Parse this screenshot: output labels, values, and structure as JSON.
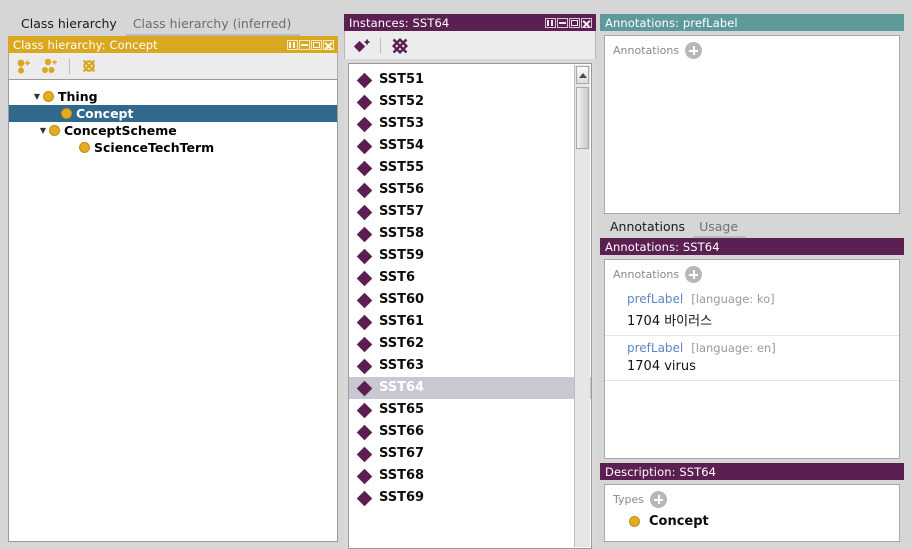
{
  "app": "Protege ontology editor",
  "class_panel": {
    "tabs": [
      {
        "label": "Class hierarchy",
        "active": true
      },
      {
        "label": "Class hierarchy (inferred)",
        "active": false
      }
    ],
    "header_title": "Class hierarchy: Concept",
    "header_color": "#d9a81e",
    "window_controls": [
      "split-icon",
      "minimize-icon",
      "maximize-icon",
      "close-icon"
    ],
    "toolbar": [
      {
        "name": "add-subclass-icon",
        "title": "Add subclass"
      },
      {
        "name": "add-sibling-class-icon",
        "title": "Add sibling class"
      },
      {
        "name": "delete-class-icon",
        "title": "Delete class"
      }
    ],
    "tree": [
      {
        "label": "Thing",
        "depth": 0,
        "twisty": "▼",
        "selected": false
      },
      {
        "label": "Concept",
        "depth": 1,
        "twisty": "",
        "selected": true
      },
      {
        "label": "ConceptScheme",
        "depth": 1,
        "twisty": "▼",
        "selected": false
      },
      {
        "label": "ScienceTechTerm",
        "depth": 2,
        "twisty": "",
        "selected": false
      }
    ]
  },
  "instances_panel": {
    "header_title": "Instances: SST64",
    "header_color": "#5b1f52",
    "window_controls": [
      "split-icon",
      "minimize-icon",
      "maximize-icon",
      "close-icon"
    ],
    "toolbar": [
      {
        "name": "add-instance-icon",
        "title": "Add individual"
      },
      {
        "name": "delete-instance-icon",
        "title": "Delete individual"
      }
    ],
    "items": [
      {
        "label": "SST51",
        "selected": false
      },
      {
        "label": "SST52",
        "selected": false
      },
      {
        "label": "SST53",
        "selected": false
      },
      {
        "label": "SST54",
        "selected": false
      },
      {
        "label": "SST55",
        "selected": false
      },
      {
        "label": "SST56",
        "selected": false
      },
      {
        "label": "SST57",
        "selected": false
      },
      {
        "label": "SST58",
        "selected": false
      },
      {
        "label": "SST59",
        "selected": false
      },
      {
        "label": "SST6",
        "selected": false
      },
      {
        "label": "SST60",
        "selected": false
      },
      {
        "label": "SST61",
        "selected": false
      },
      {
        "label": "SST62",
        "selected": false
      },
      {
        "label": "SST63",
        "selected": false
      },
      {
        "label": "SST64",
        "selected": true
      },
      {
        "label": "SST65",
        "selected": false
      },
      {
        "label": "SST66",
        "selected": false
      },
      {
        "label": "SST67",
        "selected": false
      },
      {
        "label": "SST68",
        "selected": false
      },
      {
        "label": "SST69",
        "selected": false
      }
    ]
  },
  "pref_label_panel": {
    "header_title": "Annotations: prefLabel",
    "header_color": "#5f9a9a",
    "section_label": "Annotations",
    "add_button": "plus-icon",
    "rows": []
  },
  "sub_tabs": [
    {
      "label": "Annotations",
      "active": true
    },
    {
      "label": "Usage",
      "active": false
    }
  ],
  "annotations_panel": {
    "header_title": "Annotations: SST64",
    "header_color": "#5b1f52",
    "section_label": "Annotations",
    "add_button": "plus-icon",
    "rows": [
      {
        "property": "prefLabel",
        "language": "[language: ko]",
        "value": "1704 바이러스"
      },
      {
        "property": "prefLabel",
        "language": "[language: en]",
        "value": "1704 virus"
      }
    ]
  },
  "description_panel": {
    "header_title": "Description: SST64",
    "header_color": "#5b1f52",
    "section_label": "Types",
    "add_button": "plus-icon",
    "types": [
      {
        "label": "Concept"
      }
    ]
  }
}
